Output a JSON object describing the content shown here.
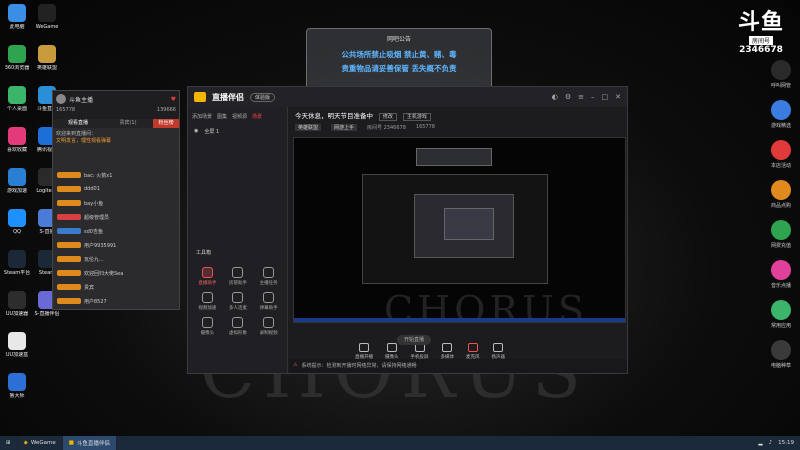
{
  "desktop_left": [
    {
      "label": "此电脑",
      "color": "#3a8ee6",
      "icon": "computer-icon"
    },
    {
      "label": "360浏览器",
      "color": "#2ea44f",
      "icon": "browser-icon"
    },
    {
      "label": "个人桌面",
      "color": "#3bb56a",
      "icon": "desktop-icon"
    },
    {
      "label": "喜欢收藏",
      "color": "#e23a7a",
      "icon": "favorite-icon"
    },
    {
      "label": "游戏加速",
      "color": "#2a7fd4",
      "icon": "speed-icon"
    },
    {
      "label": "QQ",
      "color": "#1e90ff",
      "icon": "qq-icon"
    },
    {
      "label": "Steam平台",
      "color": "#1b2838",
      "icon": "steam-icon"
    },
    {
      "label": "UU加速器",
      "color": "#2d2d2d",
      "icon": "uu-icon"
    },
    {
      "label": "UU加速盒",
      "color": "#e8e8e8",
      "icon": "doc-icon"
    },
    {
      "label": "鲁大师",
      "color": "#2c6fd6",
      "icon": "master-icon"
    }
  ],
  "desktop_left2": [
    {
      "label": "WeGame",
      "color": "#222222",
      "icon": "wegame-icon"
    },
    {
      "label": "英雄联盟",
      "color": "#c89b3c",
      "icon": "lol-icon"
    },
    {
      "label": "斗鱼直播",
      "color": "#2a8fd6",
      "icon": "douyu-icon"
    },
    {
      "label": "腾讯视频",
      "color": "#1d6ed6",
      "icon": "video-icon"
    },
    {
      "label": "Logitech",
      "color": "#2a2a2a",
      "icon": "logitech-icon"
    },
    {
      "label": "S-直播",
      "color": "#4a7bd6",
      "icon": "live-icon"
    },
    {
      "label": "Steam",
      "color": "#1b2838",
      "icon": "steam-icon"
    },
    {
      "label": "S-直播伴侣",
      "color": "#6a6ad6",
      "icon": "companion-icon"
    }
  ],
  "notice": {
    "title": "网吧公告",
    "line1": "公共场所禁止吸烟  禁止黄、赌、毒",
    "line2": "贵重物品请妥善保管  丢失概不负责"
  },
  "logo": {
    "big": "斗鱼",
    "room": "房间号",
    "num": "2346678"
  },
  "right_icons": [
    {
      "label": "呼叫网管",
      "color": "#2a2a2a",
      "icon": "call-icon"
    },
    {
      "label": "游戏精选",
      "color": "#3a7ce0",
      "icon": "game-icon"
    },
    {
      "label": "本店活动",
      "color": "#e03a3a",
      "icon": "event-icon"
    },
    {
      "label": "商品点购",
      "color": "#e08a1e",
      "icon": "shop-icon"
    },
    {
      "label": "网费充值",
      "color": "#2ea44f",
      "icon": "recharge-icon"
    },
    {
      "label": "音乐点播",
      "color": "#e0409a",
      "icon": "music-icon"
    },
    {
      "label": "常用应用",
      "color": "#3bb56a",
      "icon": "apps-icon"
    },
    {
      "label": "电脑种草",
      "color": "#3a3a3a",
      "icon": "grow-icon"
    }
  ],
  "chat": {
    "user": "斗鱼主播",
    "fans": "165778",
    "coins": "139666",
    "tabs": [
      "观看直播",
      "贵宾(1)",
      "粉丝榜"
    ],
    "notice_label": "欢迎来到直播间：",
    "notice_text": "文明发言，理性观看弹幕",
    "rows": [
      {
        "tag": "orange",
        "text": "bac: 火箭x1"
      },
      {
        "tag": "orange",
        "text": "ddd01"
      },
      {
        "tag": "orange",
        "text": "bay小鱼"
      },
      {
        "tag": "red",
        "text": "超级管理员"
      },
      {
        "tag": "blue",
        "text": "sd0吉鱼"
      },
      {
        "tag": "orange",
        "text": "用户9935991"
      },
      {
        "tag": "orange",
        "text": "瓦伦九..."
      },
      {
        "tag": "orange",
        "text": "欢迎回归大佬Sea"
      },
      {
        "tag": "orange",
        "text": "贵宾"
      },
      {
        "tag": "orange",
        "text": "用户8527"
      }
    ]
  },
  "app": {
    "brand": "直播伴侣",
    "pill": "体验版",
    "left_tabs": [
      "添加场景",
      "图集",
      "视频源",
      "场景"
    ],
    "scene": "全屏 1",
    "tools_title": "工具箱",
    "tools": [
      {
        "label": "直播助手",
        "red": true
      },
      {
        "label": "房管助手",
        "red": false
      },
      {
        "label": "主播任务",
        "red": false
      },
      {
        "label": "视频加速",
        "red": false
      },
      {
        "label": "多人连麦",
        "red": false
      },
      {
        "label": "弹幕助手",
        "red": false
      },
      {
        "label": "摄像头",
        "red": false
      },
      {
        "label": "虚拟形象",
        "red": false
      },
      {
        "label": "录制视频",
        "red": false
      }
    ],
    "title": "今天休息，明天节目准备中",
    "edit_btn": "修改",
    "category_btn": "主机游戏",
    "meta": [
      "英雄联盟",
      "网游上手",
      "房间号 2346678",
      "165778"
    ],
    "controls": [
      "直播开播",
      "摄像头",
      "手机投屏",
      "多媒体",
      "麦克风",
      "扬声器"
    ],
    "start": "开始直播",
    "bottom_warn": "系统提示：检测到开播时网络异常，请保持网络通畅",
    "bottom_text": "游戏直播已开启"
  },
  "watermark": "CHORUS",
  "taskbar": {
    "items": [
      "WeGame",
      "斗鱼直播伴侣"
    ],
    "time": "15:19"
  }
}
